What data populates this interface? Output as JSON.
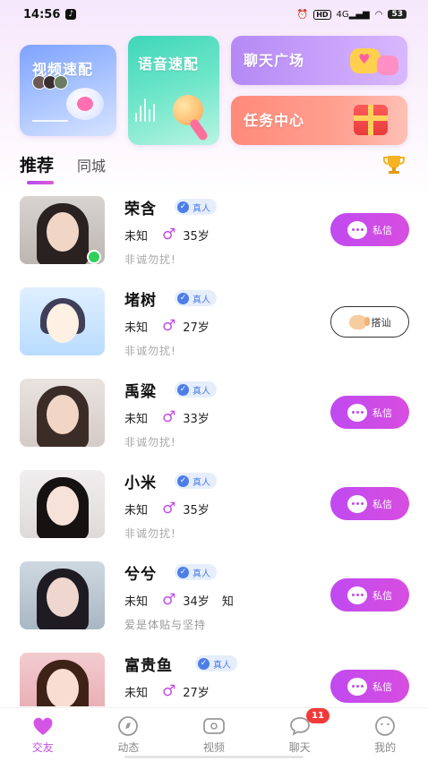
{
  "status_bar": {
    "time": "14:56",
    "network": "4G",
    "battery": "53"
  },
  "feature_cards": {
    "video_match": "视频速配",
    "voice_match": "语音速配",
    "chat_square": "聊天广场",
    "task_center": "任务中心"
  },
  "tabs": {
    "recommend": "推荐",
    "same_city": "同城"
  },
  "users": [
    {
      "name": "荣含",
      "verified": "真人",
      "location": "未知",
      "gender_symbol": "♂",
      "age": "35岁",
      "extra": "",
      "bio": "非诚勿扰!",
      "action": "私信"
    },
    {
      "name": "堵树",
      "verified": "真人",
      "location": "未知",
      "gender_symbol": "♂",
      "age": "27岁",
      "extra": "",
      "bio": "非诚勿扰!",
      "action": "搭讪"
    },
    {
      "name": "禹粱",
      "verified": "真人",
      "location": "未知",
      "gender_symbol": "♂",
      "age": "33岁",
      "extra": "",
      "bio": "非诚勿扰!",
      "action": "私信"
    },
    {
      "name": "小米",
      "verified": "真人",
      "location": "未知",
      "gender_symbol": "♂",
      "age": "35岁",
      "extra": "",
      "bio": "非诚勿扰!",
      "action": "私信"
    },
    {
      "name": "兮兮",
      "verified": "真人",
      "location": "未知",
      "gender_symbol": "♂",
      "age": "34岁",
      "extra": "知",
      "bio": "爱是体贴与坚持",
      "action": "私信"
    },
    {
      "name": "富贵鱼",
      "verified": "真人",
      "location": "未知",
      "gender_symbol": "♂",
      "age": "27岁",
      "extra": "",
      "bio": "",
      "action": "私信"
    }
  ],
  "bottom_nav": {
    "items": [
      "交友",
      "动态",
      "视频",
      "聊天",
      "我的"
    ],
    "chat_badge": "11"
  },
  "colors": {
    "accent": "#c44ee6",
    "online": "#2ed05a",
    "verified": "#4d7ee8",
    "badge": "#f23a3a"
  }
}
